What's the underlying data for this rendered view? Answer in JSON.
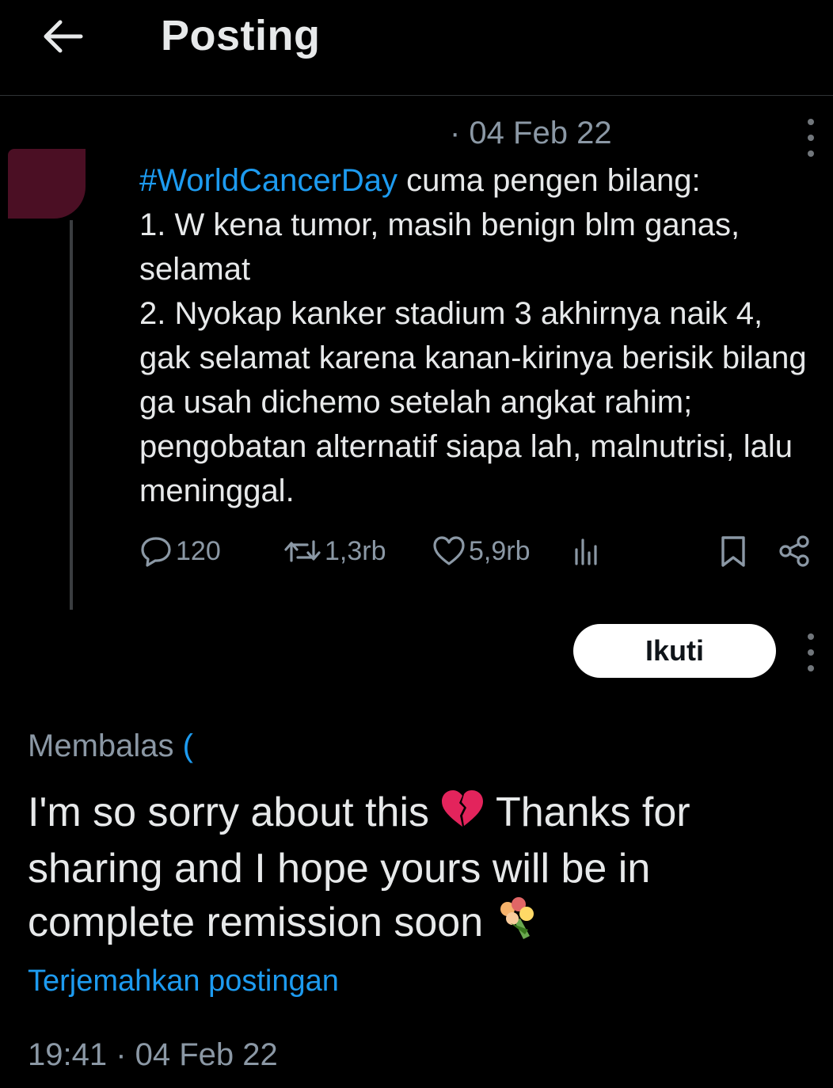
{
  "header": {
    "title": "Posting"
  },
  "original_post": {
    "date": "· 04 Feb 22",
    "hashtag": "#WorldCancerDay",
    "text_after_hashtag": " cuma pengen bilang:\n1. W kena tumor, masih benign blm ganas, selamat\n2. Nyokap kanker stadium 3 akhirnya naik 4, gak selamat karena kanan-kirinya berisik bilang ga usah dichemo setelah angkat rahim; pengobatan alternatif siapa lah, malnutrisi, lalu meninggal.",
    "stats": {
      "replies": "120",
      "reposts": "1,3rb",
      "likes": "5,9rb"
    }
  },
  "reply": {
    "follow_label": "Ikuti",
    "replying_label": "Membalas",
    "replying_handle": "(",
    "text_part1": "I'm so sorry about this ",
    "emoji1": "💔",
    "text_part2": " Thanks for sharing and I hope yours will be in complete remission soon ",
    "emoji2": "💐",
    "translate_label": "Terjemahkan postingan",
    "timestamp": "19:41 · 04 Feb 22"
  },
  "colors": {
    "background": "#000000",
    "text": "#e7e9ea",
    "muted": "#8b98a5",
    "accent": "#1d9bf0",
    "avatar": "#4b0f24"
  },
  "icons": [
    "back-arrow-icon",
    "more-vertical-icon",
    "reply-icon",
    "repost-icon",
    "like-icon",
    "views-icon",
    "bookmark-icon",
    "share-icon",
    "broken-heart-emoji",
    "bouquet-emoji"
  ]
}
